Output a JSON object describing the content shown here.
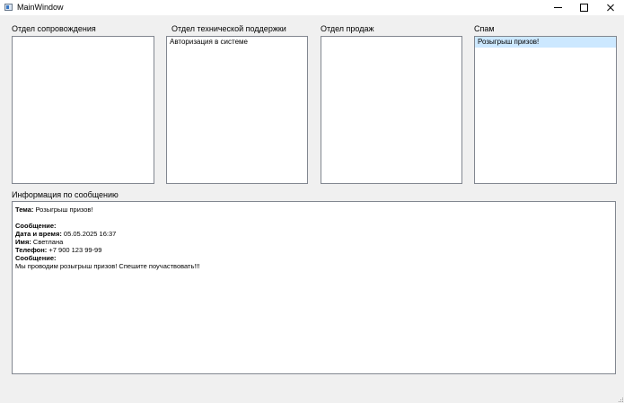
{
  "window": {
    "title": "MainWindow"
  },
  "columns": [
    {
      "label": "Отдел сопровождения",
      "items": []
    },
    {
      "label": "Отдел технической поддержки",
      "items": [
        "Авторизация в системе"
      ]
    },
    {
      "label": "Отдел продаж",
      "items": []
    },
    {
      "label": "Спам",
      "items": [
        "Розыгрыш призов!"
      ],
      "selected_item": "Розыгрыш призов!"
    }
  ],
  "info": {
    "label": "Информация по сообщению",
    "topic_label": "Тема:",
    "topic_value": "Розыгрыш призов!",
    "message_header": "Сообщение:",
    "datetime_label": "Дата и время:",
    "datetime_value": "05.05.2025 16:37",
    "name_label": "Имя:",
    "name_value": "Светлана",
    "phone_label": "Телефон:",
    "phone_value": "+7 900 123 99-99",
    "body_label": "Сообщение:",
    "body_value": "Мы проводим розыгрыш призов! Спешите поучаствовать!!!"
  },
  "colors": {
    "selection": "#cce8ff",
    "border": "#828790",
    "background": "#f0f0f0"
  }
}
